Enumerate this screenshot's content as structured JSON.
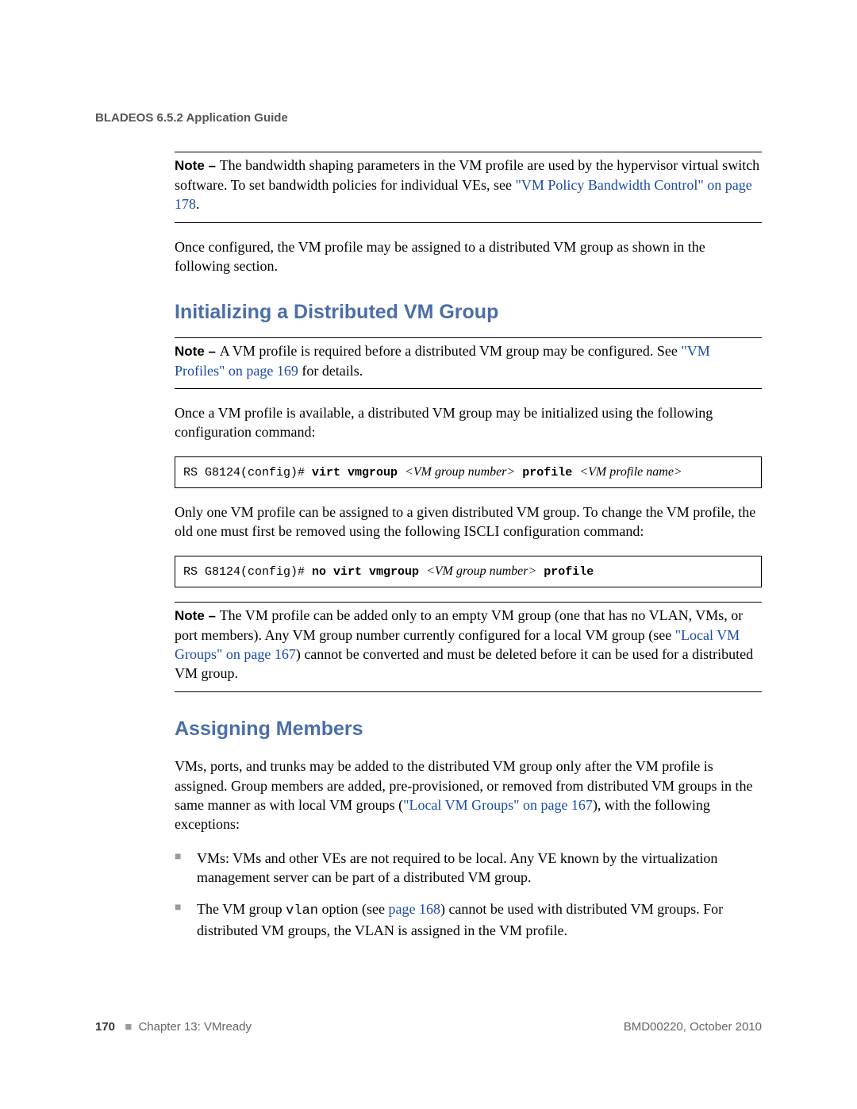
{
  "header": {
    "title": "BLADEOS 6.5.2 Application Guide"
  },
  "note1": {
    "label": "Note – ",
    "text_before_link": "The bandwidth shaping parameters in the VM profile are used by the hypervisor virtual switch software. To set bandwidth policies for individual VEs, see ",
    "link": "\"VM Policy Bandwidth Control\" on page 178",
    "text_after_link": "."
  },
  "para_after_note1": "Once configured, the VM profile may be assigned to a distributed VM group as shown in the following section.",
  "heading1": "Initializing a Distributed VM Group",
  "note2": {
    "label": "Note – ",
    "text_before_link": "A VM profile is required before a distributed VM group may be configured. See ",
    "link": "\"VM Profiles\" on page 169",
    "text_after_link": " for details."
  },
  "para2": "Once a VM profile is available, a distributed VM group may be initialized using the following configuration command:",
  "cmd1": {
    "prefix": "RS G8124(config)# ",
    "b1": "virt vmgroup ",
    "i1": "<VM group number>",
    "b2": " profile ",
    "i2": "<VM profile name>"
  },
  "para3": "Only one VM profile can be assigned to a given distributed VM group. To change the VM profile, the old one must first be removed using the following ISCLI configuration command:",
  "cmd2": {
    "prefix": "RS G8124(config)# ",
    "b1": "no virt vmgroup ",
    "i1": "<VM group number>",
    "b2": " profile"
  },
  "note3": {
    "label": "Note – ",
    "text_before_link": "The VM profile can be added only to an empty VM group (one that has no VLAN, VMs, or port members). Any VM group number currently configured for a local VM group (see ",
    "link": "\"Local VM Groups\" on page 167",
    "text_after_link": ") cannot be converted and must be deleted before it can be used for a distributed VM group."
  },
  "heading2": "Assigning Members",
  "para4": {
    "before": "VMs, ports, and trunks may be added to the distributed VM group only after the VM profile is assigned. Group members are added, pre-provisioned, or removed from distributed VM groups in the same manner as with local VM groups (",
    "link": "\"Local VM Groups\" on page 167",
    "after": "), with the following exceptions:"
  },
  "bullets": [
    {
      "text": "VMs: VMs and other VEs are not required to be local. Any VE known by the virtualization management server can be part of a distributed VM group."
    },
    {
      "before": "The VM group ",
      "mono": "vlan",
      "mid": " option (see ",
      "link": "page 168",
      "after": ") cannot be used with distributed VM groups. For distributed VM groups, the VLAN is assigned in the VM profile."
    }
  ],
  "footer": {
    "page_num": "170",
    "chapter": "Chapter 13: VMready",
    "doc_id": "BMD00220, October 2010"
  }
}
